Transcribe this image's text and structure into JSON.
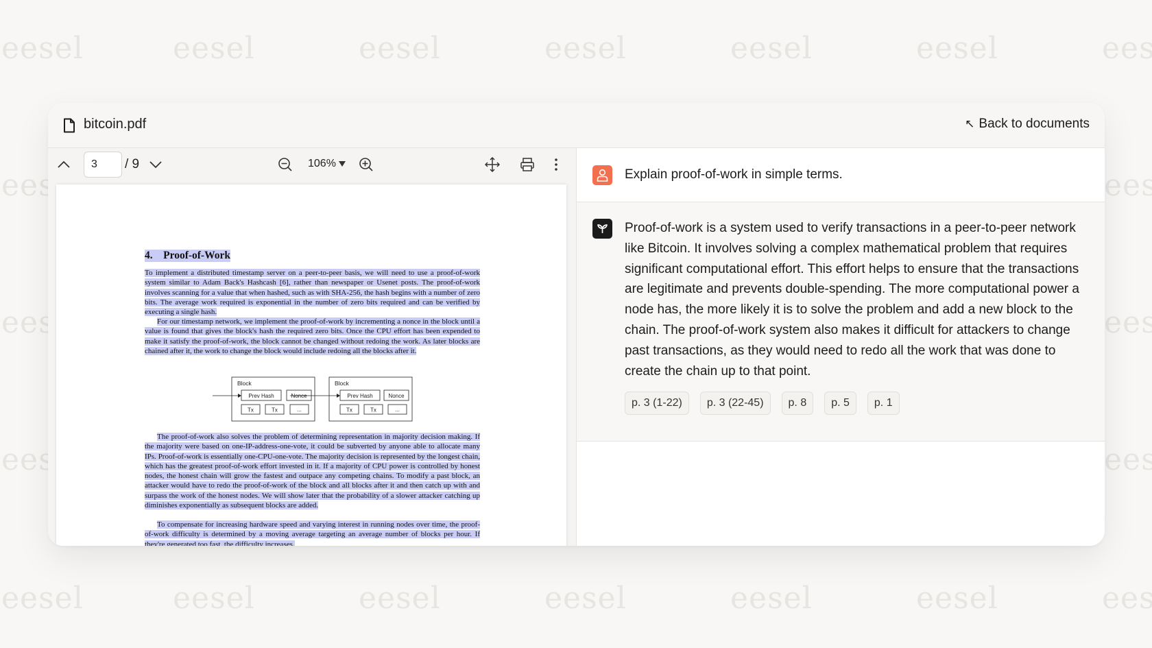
{
  "watermark": {
    "text": "eesel"
  },
  "header": {
    "file_name": "bitcoin.pdf",
    "back_label": "Back to documents"
  },
  "toolbar": {
    "page_current": "3",
    "page_total": "/ 9",
    "zoom": "106%"
  },
  "pdf": {
    "section_number": "4.",
    "section_title": "Proof-of-Work",
    "para1": "To implement a distributed timestamp server on a peer-to-peer basis, we will need to use a proof-of-work system similar to Adam Back's Hashcash [6], rather than newspaper or Usenet posts. The proof-of-work involves scanning for a value that when hashed, such as with SHA-256, the hash begins with a number of zero bits. The average work required is exponential in the number of zero bits required and can be verified by executing a single hash.",
    "para2": "For our timestamp network, we implement the proof-of-work by incrementing a nonce in the block until a value is found that gives the block's hash the required zero bits. Once the CPU effort has been expended to make it satisfy the proof-of-work, the block cannot be changed without redoing the work. As later blocks are chained after it, the work to change the block would include redoing all the blocks after it.",
    "para3": "The proof-of-work also solves the problem of determining representation in majority decision making. If the majority were based on one-IP-address-one-vote, it could be subverted by anyone able to allocate many IPs. Proof-of-work is essentially one-CPU-one-vote. The majority decision is represented by the longest chain, which has the greatest proof-of-work effort invested in it. If a majority of CPU power is controlled by honest nodes, the honest chain will grow the fastest and outpace any competing chains. To modify a past block, an attacker would have to redo the proof-of-work of the block and all blocks after it and then catch up with and surpass the work of the honest nodes. We will show later that the probability of a slower attacker catching up diminishes exponentially as subsequent blocks are added.",
    "para4": "To compensate for increasing hardware speed and varying interest in running nodes over time, the proof-of-work difficulty is determined by a moving average targeting an average number of blocks per hour. If they're generated too fast, the difficulty increases.",
    "diagram": {
      "block_label": "Block",
      "prev_hash": "Prev Hash",
      "nonce": "Nonce",
      "tx": "Tx",
      "ellipsis": "..."
    }
  },
  "chat": {
    "user_message": "Explain proof-of-work in simple terms.",
    "bot_message": "Proof-of-work is a system used to verify transactions in a peer-to-peer network like Bitcoin. It involves solving a complex mathematical problem that requires significant computational effort. This effort helps to ensure that the transactions are legitimate and prevents double-spending. The more computational power a node has, the more likely it is to solve the problem and add a new block to the chain. The proof-of-work system also makes it difficult for attackers to change past transactions, as they would need to redo all the work that was done to create the chain up to that point.",
    "citations": [
      "p. 3 (1-22)",
      "p. 3 (22-45)",
      "p. 8",
      "p. 5",
      "p. 1"
    ]
  },
  "colors": {
    "user_avatar": "#f26f4f",
    "bot_avatar": "#1b1b1b",
    "highlight": "#c9cdf6"
  }
}
